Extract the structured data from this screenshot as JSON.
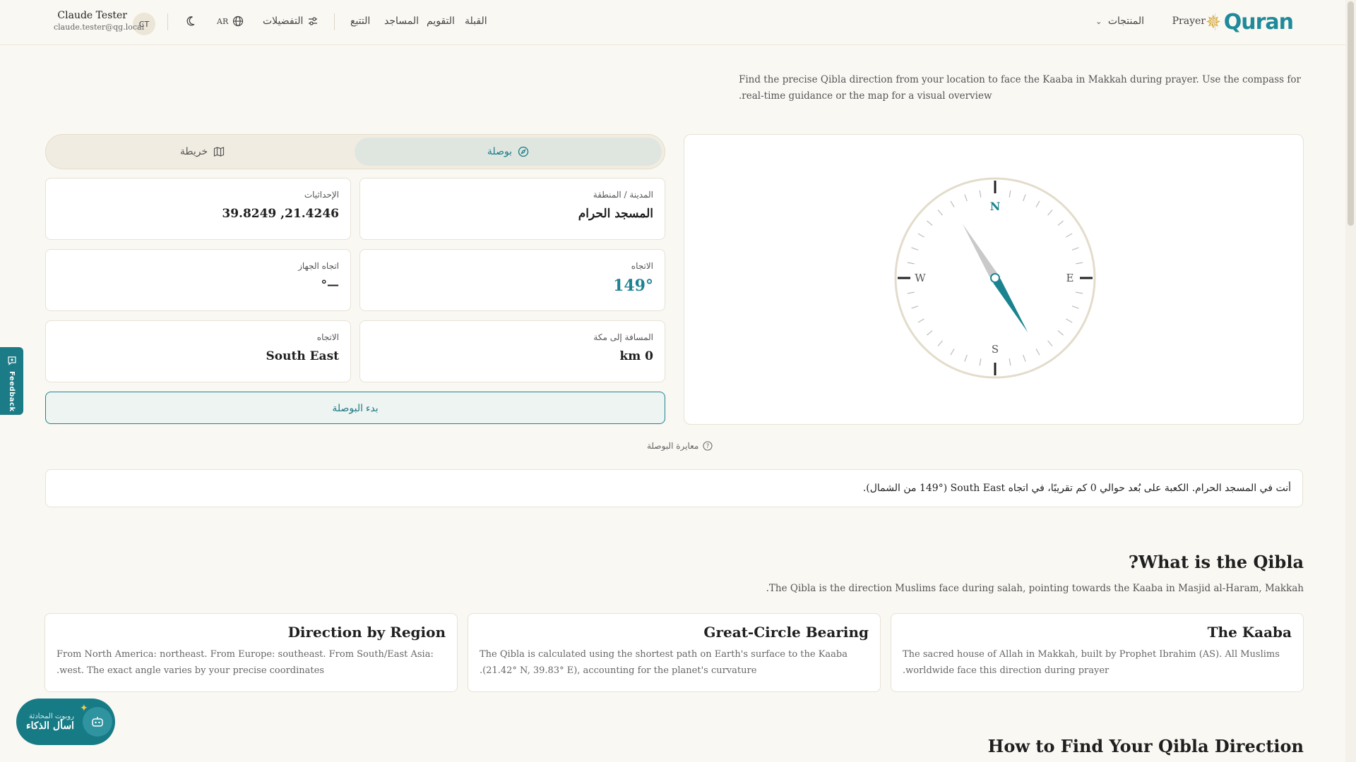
{
  "header": {
    "logo_text": "Quran",
    "nav_products": "المنتجات",
    "nav_prayer": "Prayer",
    "nav_links": [
      "القبلة",
      "التقويم",
      "المساجد",
      "التتبع"
    ],
    "preferences": "التفضيلات",
    "language": "AR",
    "user_initials": "CT",
    "user_name": "Claude Tester",
    "user_email": "claude.tester@qg.local"
  },
  "intro": "Find the precise Qibla direction from your location to face the Kaaba in Makkah during prayer. Use the compass for real-time guidance or the map for a visual overview.",
  "tabs": {
    "compass": "بوصلة",
    "map": "خريطة",
    "active": "compass"
  },
  "compass": {
    "N": "N",
    "E": "E",
    "S": "S",
    "W": "W",
    "bearing_degrees": 149
  },
  "info": {
    "city_label": "المدينة / المنطقة",
    "city_value": "المسجد الحرام",
    "coords_label": "الإحداثيات",
    "coords_value": "21.4246, 39.8249",
    "direction_label": "الاتجاه",
    "direction_value": "149°",
    "device_label": "اتجاه الجهاز",
    "device_value": "—°",
    "distance_label": "المسافة إلى مكة",
    "distance_value": "0 km",
    "heading_label": "الاتجاه",
    "heading_value": "South East"
  },
  "start_button": "بدء البوصلة",
  "calibrate": "معايرة البوصلة",
  "summary": "أنت في المسجد الحرام. الكعبة على بُعد حوالي 0 كم تقريبًا، في اتجاه South East (149° من الشمال).",
  "what_is": {
    "title": "What is the Qibla?",
    "subtitle": "The Qibla is the direction Muslims face during salah, pointing towards the Kaaba in Masjid al-Haram, Makkah.",
    "cards": [
      {
        "title": "The Kaaba",
        "text": "The sacred house of Allah in Makkah, built by Prophet Ibrahim (AS). All Muslims worldwide face this direction during prayer."
      },
      {
        "title": "Great-Circle Bearing",
        "text": "The Qibla is calculated using the shortest path on Earth's surface to the Kaaba (21.42° N, 39.83° E), accounting for the planet's curvature."
      },
      {
        "title": "Direction by Region",
        "text": "From North America: northeast. From Europe: southeast. From South/East Asia: west. The exact angle varies by your precise coordinates."
      }
    ]
  },
  "how_to": {
    "title": "How to Find Your Qibla Direction"
  },
  "feedback": "Feedback",
  "ai": {
    "small": "روبوت المحادثة",
    "big": "اسأل الذكاء"
  },
  "colors": {
    "accent": "#1d8292",
    "background": "#faf8f3",
    "gold": "#d8a93a"
  }
}
